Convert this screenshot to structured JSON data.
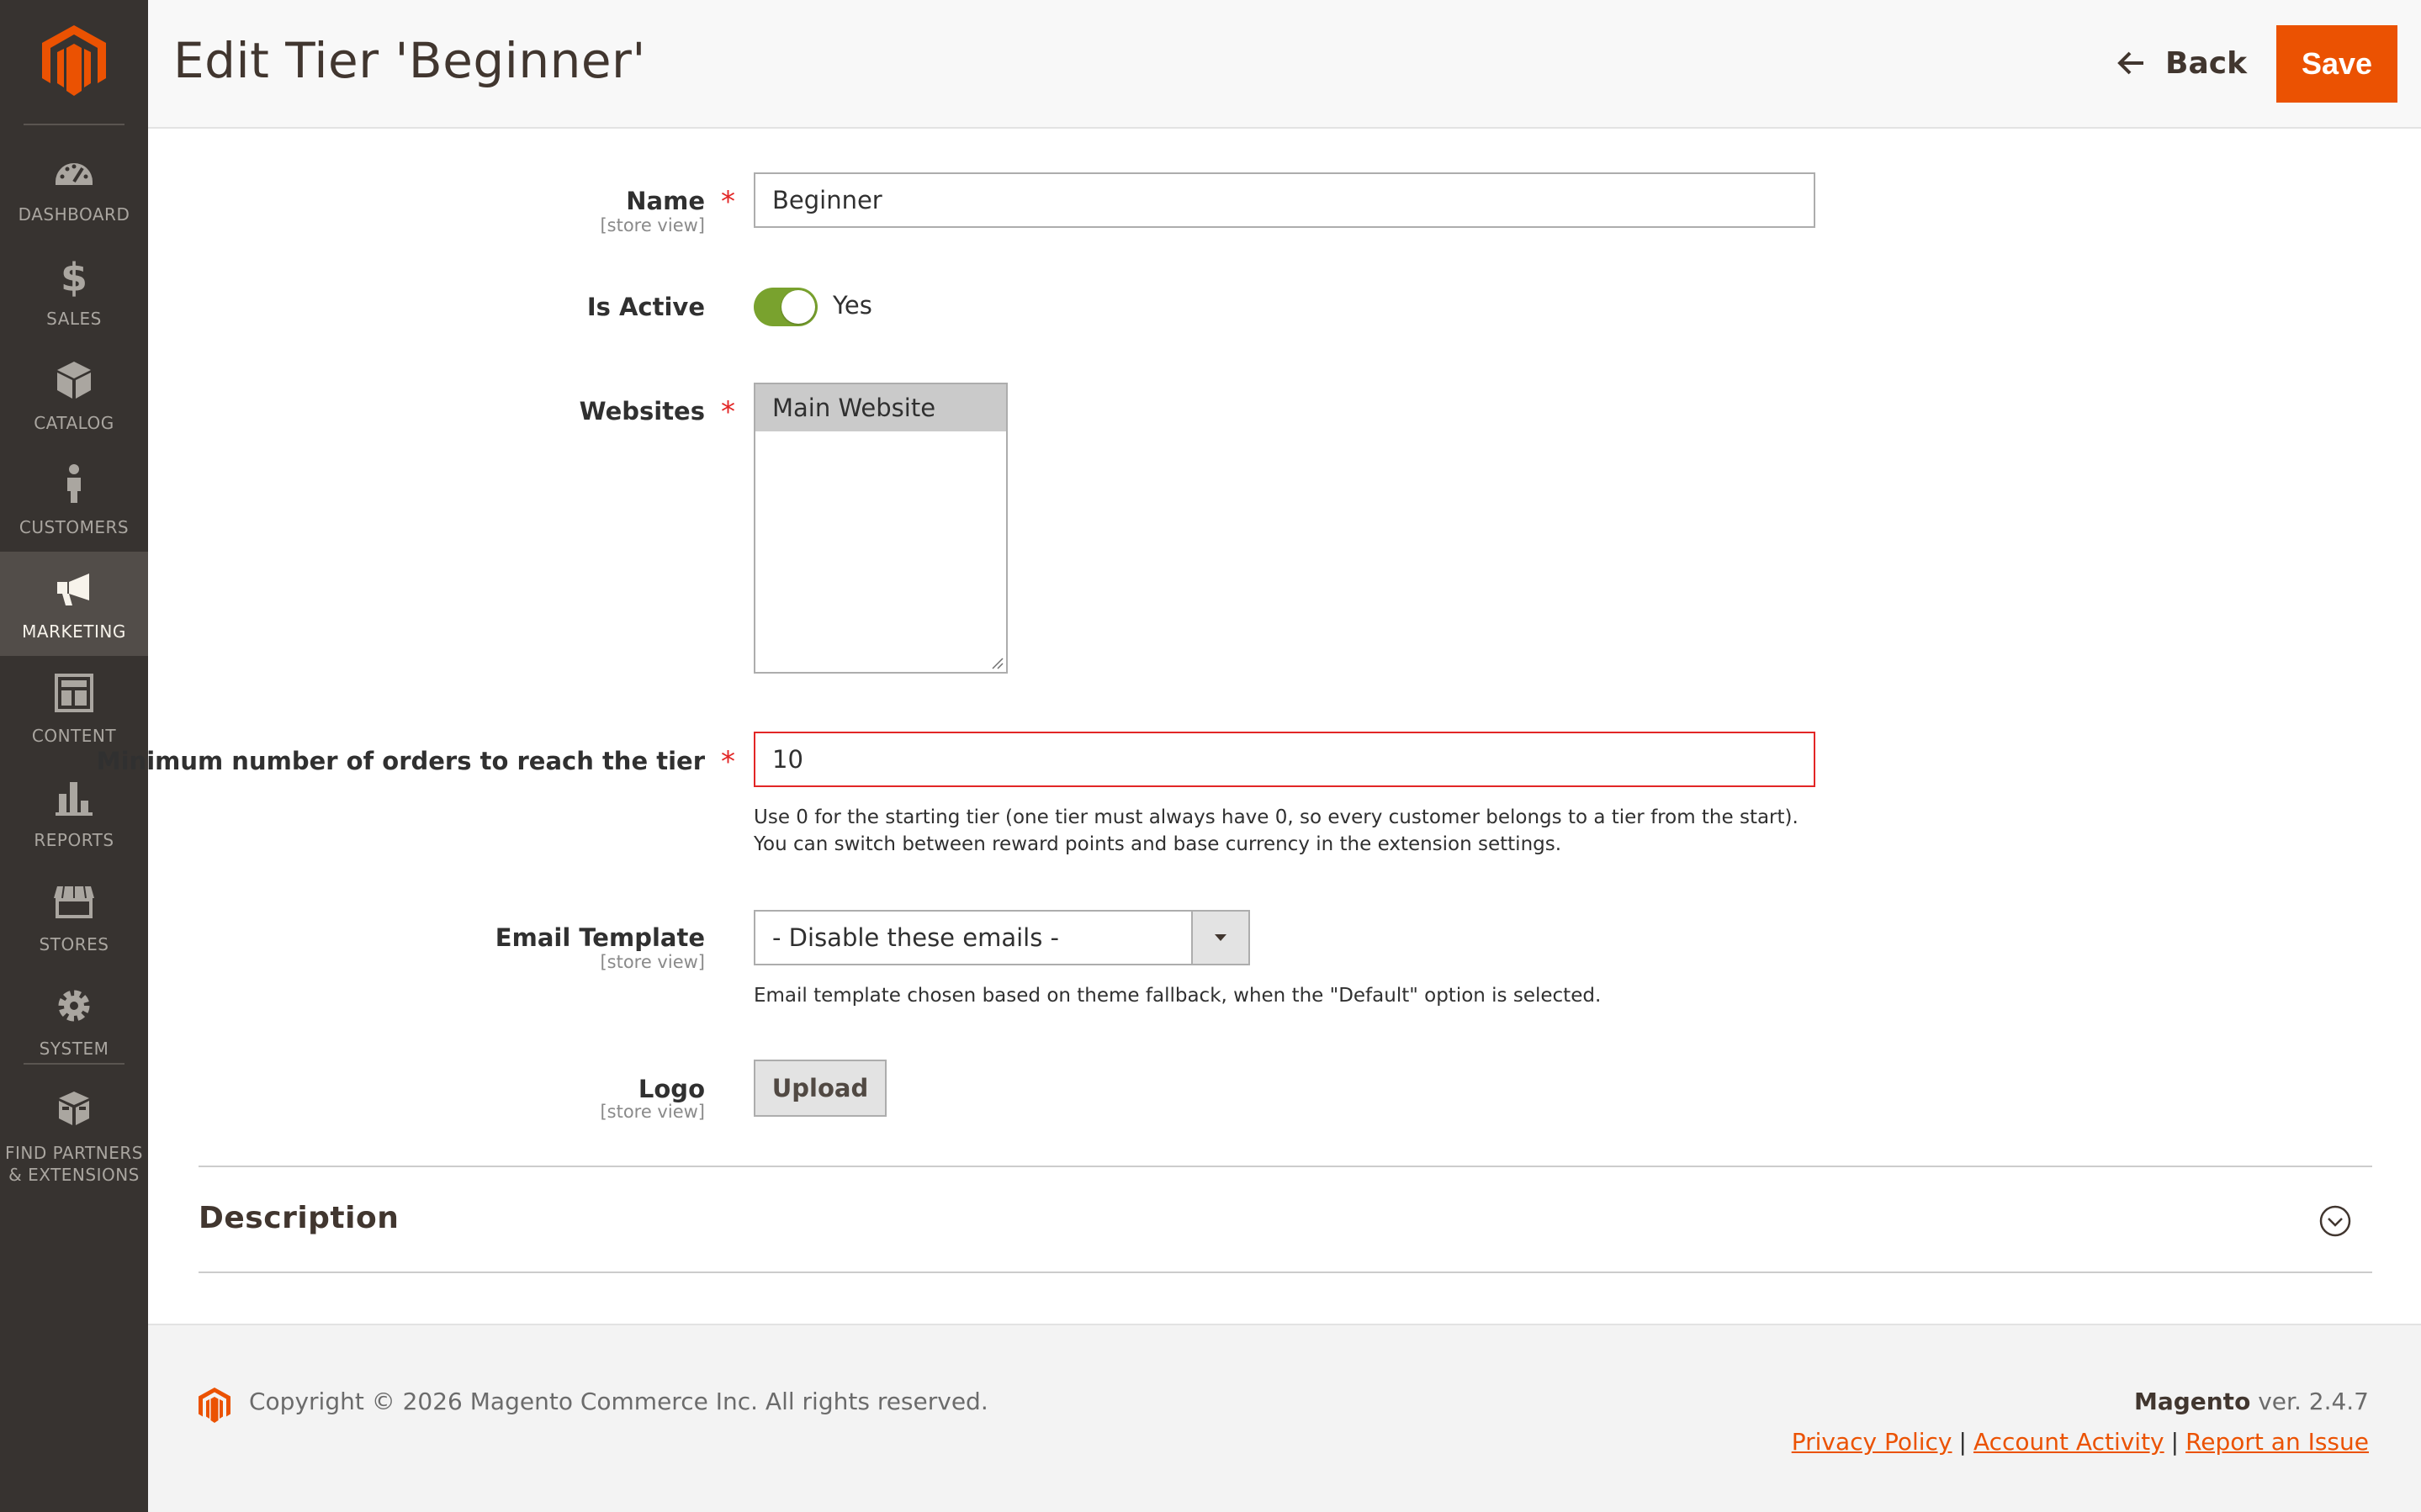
{
  "app": {
    "brand_color": "#eb5202",
    "sidebar_bg": "#373330"
  },
  "sidebar": {
    "items": [
      {
        "label": "DASHBOARD",
        "icon": "dashboard-icon"
      },
      {
        "label": "SALES",
        "icon": "dollar-icon"
      },
      {
        "label": "CATALOG",
        "icon": "box-icon"
      },
      {
        "label": "CUSTOMERS",
        "icon": "person-icon"
      },
      {
        "label": "MARKETING",
        "icon": "megaphone-icon",
        "active": true
      },
      {
        "label": "CONTENT",
        "icon": "layout-icon"
      },
      {
        "label": "REPORTS",
        "icon": "bar-chart-icon"
      },
      {
        "label": "STORES",
        "icon": "storefront-icon"
      },
      {
        "label": "SYSTEM",
        "icon": "gear-icon"
      },
      {
        "label_line1": "FIND PARTNERS",
        "label_line2": "& EXTENSIONS",
        "icon": "partners-icon"
      }
    ]
  },
  "header": {
    "title": "Edit Tier 'Beginner'",
    "back_label": "Back",
    "save_label": "Save"
  },
  "form": {
    "name": {
      "label": "Name",
      "scope": "[store view]",
      "value": "Beginner",
      "required": "*"
    },
    "is_active": {
      "label": "Is Active",
      "state": "Yes",
      "on": true
    },
    "websites": {
      "label": "Websites",
      "required": "*",
      "options": [
        "Main Website"
      ],
      "selected": "Main Website"
    },
    "min_orders": {
      "label": "Minimum number of orders to reach the tier",
      "required": "*",
      "value": "10",
      "note": "Use 0 for the starting tier (one tier must always have 0, so every customer belongs to a tier from the start). You can switch between reward points and base currency in the extension settings."
    },
    "email_template": {
      "label": "Email Template",
      "scope": "[store view]",
      "selected": "- Disable these emails -",
      "note": "Email template chosen based on theme fallback, when the \"Default\" option is selected."
    },
    "logo": {
      "label": "Logo",
      "scope": "[store view]",
      "button": "Upload"
    }
  },
  "description": {
    "title": "Description"
  },
  "footer": {
    "copyright": "Copyright © 2026 Magento Commerce Inc. All rights reserved.",
    "brand": "Magento",
    "version": " ver. 2.4.7",
    "links": {
      "privacy": "Privacy Policy",
      "activity": "Account Activity",
      "report": "Report an Issue"
    }
  }
}
